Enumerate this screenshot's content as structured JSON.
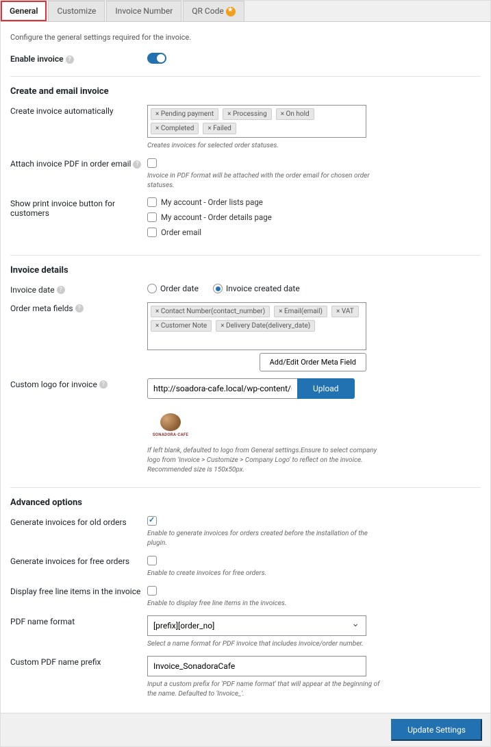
{
  "tabs": {
    "general": "General",
    "customize": "Customize",
    "invoice_number": "Invoice Number",
    "qrcode": "QR Code"
  },
  "intro": "Configure the general settings required for the invoice.",
  "enable_invoice_label": "Enable invoice",
  "sections": {
    "create_email": "Create and email invoice",
    "invoice_details": "Invoice details",
    "advanced": "Advanced options"
  },
  "create_auto": {
    "label": "Create invoice automatically",
    "tags": [
      "× Pending payment",
      "× Processing",
      "× On hold",
      "× Completed",
      "× Failed"
    ],
    "desc": "Creates invoices for selected order statuses."
  },
  "attach_pdf": {
    "label": "Attach invoice PDF in order email",
    "desc": "Invoice in PDF format will be attached with the order email for chosen order statuses."
  },
  "print_button": {
    "label": "Show print invoice button for customers",
    "opt1": "My account - Order lists page",
    "opt2": "My account - Order details page",
    "opt3": "Order email"
  },
  "invoice_date": {
    "label": "Invoice date",
    "opt1": "Order date",
    "opt2": "Invoice created date"
  },
  "meta_fields": {
    "label": "Order meta fields",
    "tags": [
      "× Contact Number(contact_number)",
      "× Email(email)",
      "× VAT",
      "× Customer Note",
      "× Delivery Date(delivery_date)"
    ],
    "btn": "Add/Edit Order Meta Field"
  },
  "custom_logo": {
    "label": "Custom logo for invoice",
    "url": "http://soadora-cafe.local/wp-content/up",
    "upload": "Upload",
    "brand": "SONADORA·CAFE",
    "desc": "If left blank, defaulted to logo from General settings.Ensure to select company logo from 'Invoice > Customize > Company Logo' to reflect on the invoice. Recommended size is 150x50px."
  },
  "gen_old": {
    "label": "Generate invoices for old orders",
    "desc": "Enable to generate invoices for orders created before the installation of the plugin."
  },
  "gen_free": {
    "label": "Generate invoices for free orders",
    "desc": "Enable to create invoices for free orders."
  },
  "disp_free": {
    "label": "Display free line items in the invoice",
    "desc": "Enable to display free line items in the invoices."
  },
  "pdf_name": {
    "label": "PDF name format",
    "value": "[prefix][order_no]",
    "desc": "Select a name format for PDF invoice that includes invoice/order number."
  },
  "prefix": {
    "label": "Custom PDF name prefix",
    "value": "Invoice_SonadoraCafe",
    "desc": "Input a custom prefix for 'PDF name format' that will appear at the beginning of the name. Defaulted to 'Invoice_'."
  },
  "update_btn": "Update Settings",
  "help": "?"
}
